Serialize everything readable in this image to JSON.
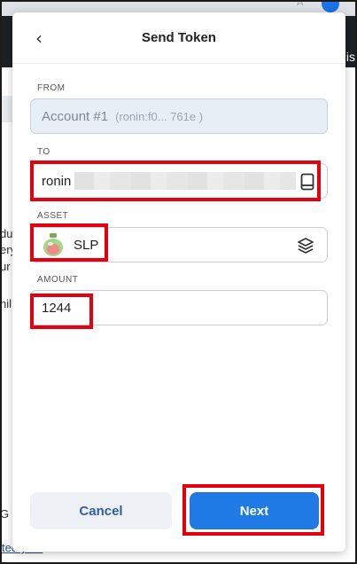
{
  "background_page": {
    "top_right_text": "is",
    "fragments": [
      "du",
      "ery",
      "ur",
      "hil",
      "G"
    ],
    "bottom_link": "ted yet?"
  },
  "popup": {
    "title": "Send Token",
    "from": {
      "label": "FROM",
      "account": "Account #1",
      "address": "(ronin:f0... 761e )"
    },
    "to": {
      "label": "TO",
      "value": "ronin"
    },
    "asset": {
      "label": "ASSET",
      "value": "SLP"
    },
    "amount": {
      "label": "AMOUNT",
      "value": "1244"
    },
    "buttons": {
      "cancel": "Cancel",
      "next": "Next"
    }
  },
  "colors": {
    "accent": "#1f7ae6",
    "highlight": "#e3000f",
    "cancel_text": "#2f5ea8"
  }
}
